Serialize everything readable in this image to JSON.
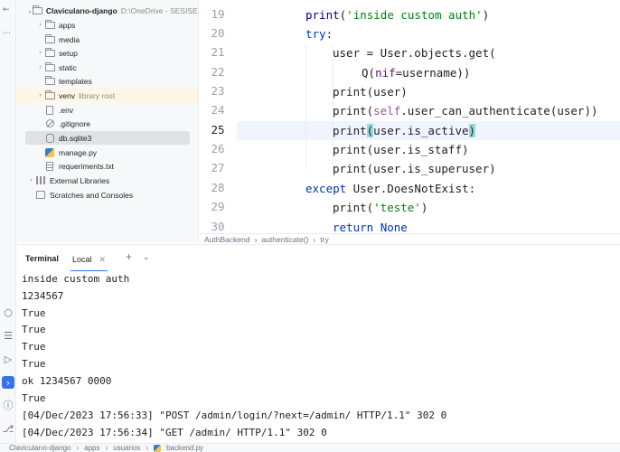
{
  "project": {
    "root_name": "Clavicularıo-django",
    "root_path": "D:\\OneDrive - SESISEN/",
    "items": [
      {
        "label": "apps",
        "type": "folder",
        "expandable": true
      },
      {
        "label": "media",
        "type": "folder",
        "expandable": false
      },
      {
        "label": "setup",
        "type": "folder",
        "expandable": true
      },
      {
        "label": "static",
        "type": "folder",
        "expandable": true
      },
      {
        "label": "templates",
        "type": "folder",
        "expandable": false
      },
      {
        "label": "venv",
        "type": "folder",
        "expandable": true,
        "note": "library root"
      },
      {
        "label": ".env",
        "type": "file"
      },
      {
        "label": ".gitignore",
        "type": "ignore"
      },
      {
        "label": "db.sqlite3",
        "type": "db"
      },
      {
        "label": "manage.py",
        "type": "python"
      },
      {
        "label": "requeriments.txt",
        "type": "text"
      }
    ],
    "external_libraries": "External Libraries",
    "scratches": "Scratches and Consoles"
  },
  "editor": {
    "line_numbers": [
      "19",
      "20",
      "21",
      "22",
      "23",
      "24",
      "25",
      "26",
      "27",
      "28",
      "29",
      "30"
    ],
    "current_line": "25",
    "code": {
      "l19_fn": "print",
      "l19_str": "'inside custom auth'",
      "l19_close": ")",
      "l20_kw": "try",
      "l20_rest": ":",
      "l21_a": "user = User.objects.get(",
      "l22_a": "Q(",
      "l22_param": "nif",
      "l22_b": "=username))",
      "l23_a": "print(user)",
      "l24_a": "print(",
      "l24_self": "self",
      "l24_b": ".user_can_authenticate(user))",
      "l25_a": "print",
      "l25_open": "(",
      "l25_b": "user.is_active",
      "l25_close": ")",
      "l26_a": "print(user.is_staff)",
      "l27_a": "print(user.is_superuser)",
      "l28_kw": "except",
      "l28_rest": " User.DoesNotExist:",
      "l29_a": "print(",
      "l29_str": "'teste'",
      "l29_b": ")",
      "l30_kw": "return",
      "l30_rest": " ",
      "l30_none": "None"
    },
    "breadcrumb": [
      "AuthBackend",
      "authenticate()",
      "try"
    ]
  },
  "terminal": {
    "title": "Terminal",
    "tab": "Local",
    "lines": [
      "inside custom auth",
      "1234567",
      "True",
      "True",
      "True",
      "True",
      "ok 1234567 0000",
      "True",
      "[04/Dec/2023 17:56:33] \"POST /admin/login/?next=/admin/ HTTP/1.1\" 302 0",
      "[04/Dec/2023 17:56:34] \"GET /admin/ HTTP/1.1\" 302 0"
    ]
  },
  "statusbar": {
    "crumbs": [
      "Clavicularıo-django",
      "apps",
      "usuarios",
      "backend.py"
    ]
  }
}
